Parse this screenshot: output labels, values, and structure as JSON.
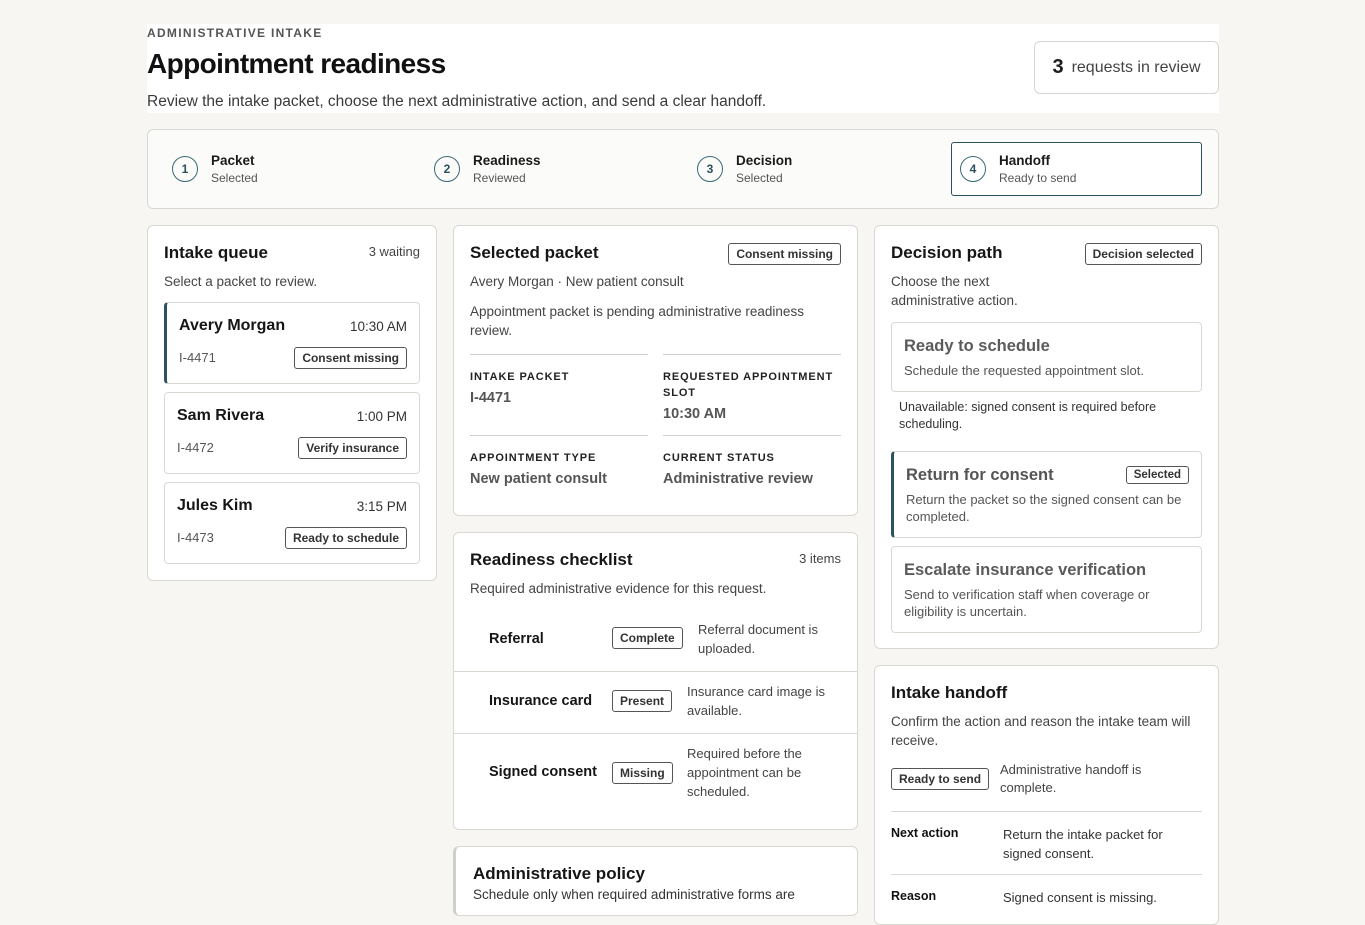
{
  "header": {
    "eyebrow": "ADMINISTRATIVE INTAKE",
    "title": "Appointment readiness",
    "subtitle": "Review the intake packet, choose the next administrative action, and send a clear handoff.",
    "review_count": "3",
    "review_label": "requests in review"
  },
  "steps": [
    {
      "num": "1",
      "label": "Packet",
      "sub": "Selected"
    },
    {
      "num": "2",
      "label": "Readiness",
      "sub": "Reviewed"
    },
    {
      "num": "3",
      "label": "Decision",
      "sub": "Selected"
    },
    {
      "num": "4",
      "label": "Handoff",
      "sub": "Ready to send"
    }
  ],
  "queue": {
    "title": "Intake queue",
    "meta": "3 waiting",
    "desc": "Select a packet to review.",
    "items": [
      {
        "name": "Avery Morgan",
        "time": "10:30 AM",
        "id": "I-4471",
        "status": "Consent missing"
      },
      {
        "name": "Sam Rivera",
        "time": "1:00 PM",
        "id": "I-4472",
        "status": "Verify insurance"
      },
      {
        "name": "Jules Kim",
        "time": "3:15 PM",
        "id": "I-4473",
        "status": "Ready to schedule"
      }
    ]
  },
  "packet": {
    "title": "Selected packet",
    "badge": "Consent missing",
    "patient": "Avery Morgan · New patient consult",
    "desc": "Appointment packet is pending administrative readiness review.",
    "fields": [
      {
        "key": "INTAKE PACKET",
        "value": "I-4471"
      },
      {
        "key": "REQUESTED APPOINTMENT SLOT",
        "value": "10:30 AM"
      },
      {
        "key": "APPOINTMENT TYPE",
        "value": "New patient consult"
      },
      {
        "key": "CURRENT STATUS",
        "value": "Administrative review"
      }
    ]
  },
  "checklist": {
    "title": "Readiness checklist",
    "meta": "3 items",
    "desc": "Required administrative evidence for this request.",
    "items": [
      {
        "name": "Referral",
        "status": "Complete",
        "note": "Referral document is uploaded."
      },
      {
        "name": "Insurance card",
        "status": "Present",
        "note": "Insurance card image is available."
      },
      {
        "name": "Signed consent",
        "status": "Missing",
        "note": "Required before the appointment can be scheduled."
      }
    ]
  },
  "policy": {
    "title": "Administrative policy",
    "text": "Schedule only when required administrative forms are"
  },
  "decision": {
    "title": "Decision path",
    "badge": "Decision selected",
    "desc": "Choose the next administrative action.",
    "options": [
      {
        "title": "Ready to schedule",
        "desc": "Schedule the requested appointment slot."
      },
      {
        "title": "Return for consent",
        "desc": "Return the packet so the signed consent can be completed.",
        "badge": "Selected"
      },
      {
        "title": "Escalate insurance verification",
        "desc": "Send to verification staff when coverage or eligibility is uncertain."
      }
    ],
    "unavailable": "Unavailable: signed consent is required before scheduling."
  },
  "handoff": {
    "title": "Intake handoff",
    "desc": "Confirm the action and reason the intake team will receive.",
    "status": "Ready to send",
    "status_note": "Administrative handoff is complete.",
    "rows": [
      {
        "key": "Next action",
        "value": "Return the intake packet for signed consent."
      },
      {
        "key": "Reason",
        "value": "Signed consent is missing."
      }
    ]
  }
}
